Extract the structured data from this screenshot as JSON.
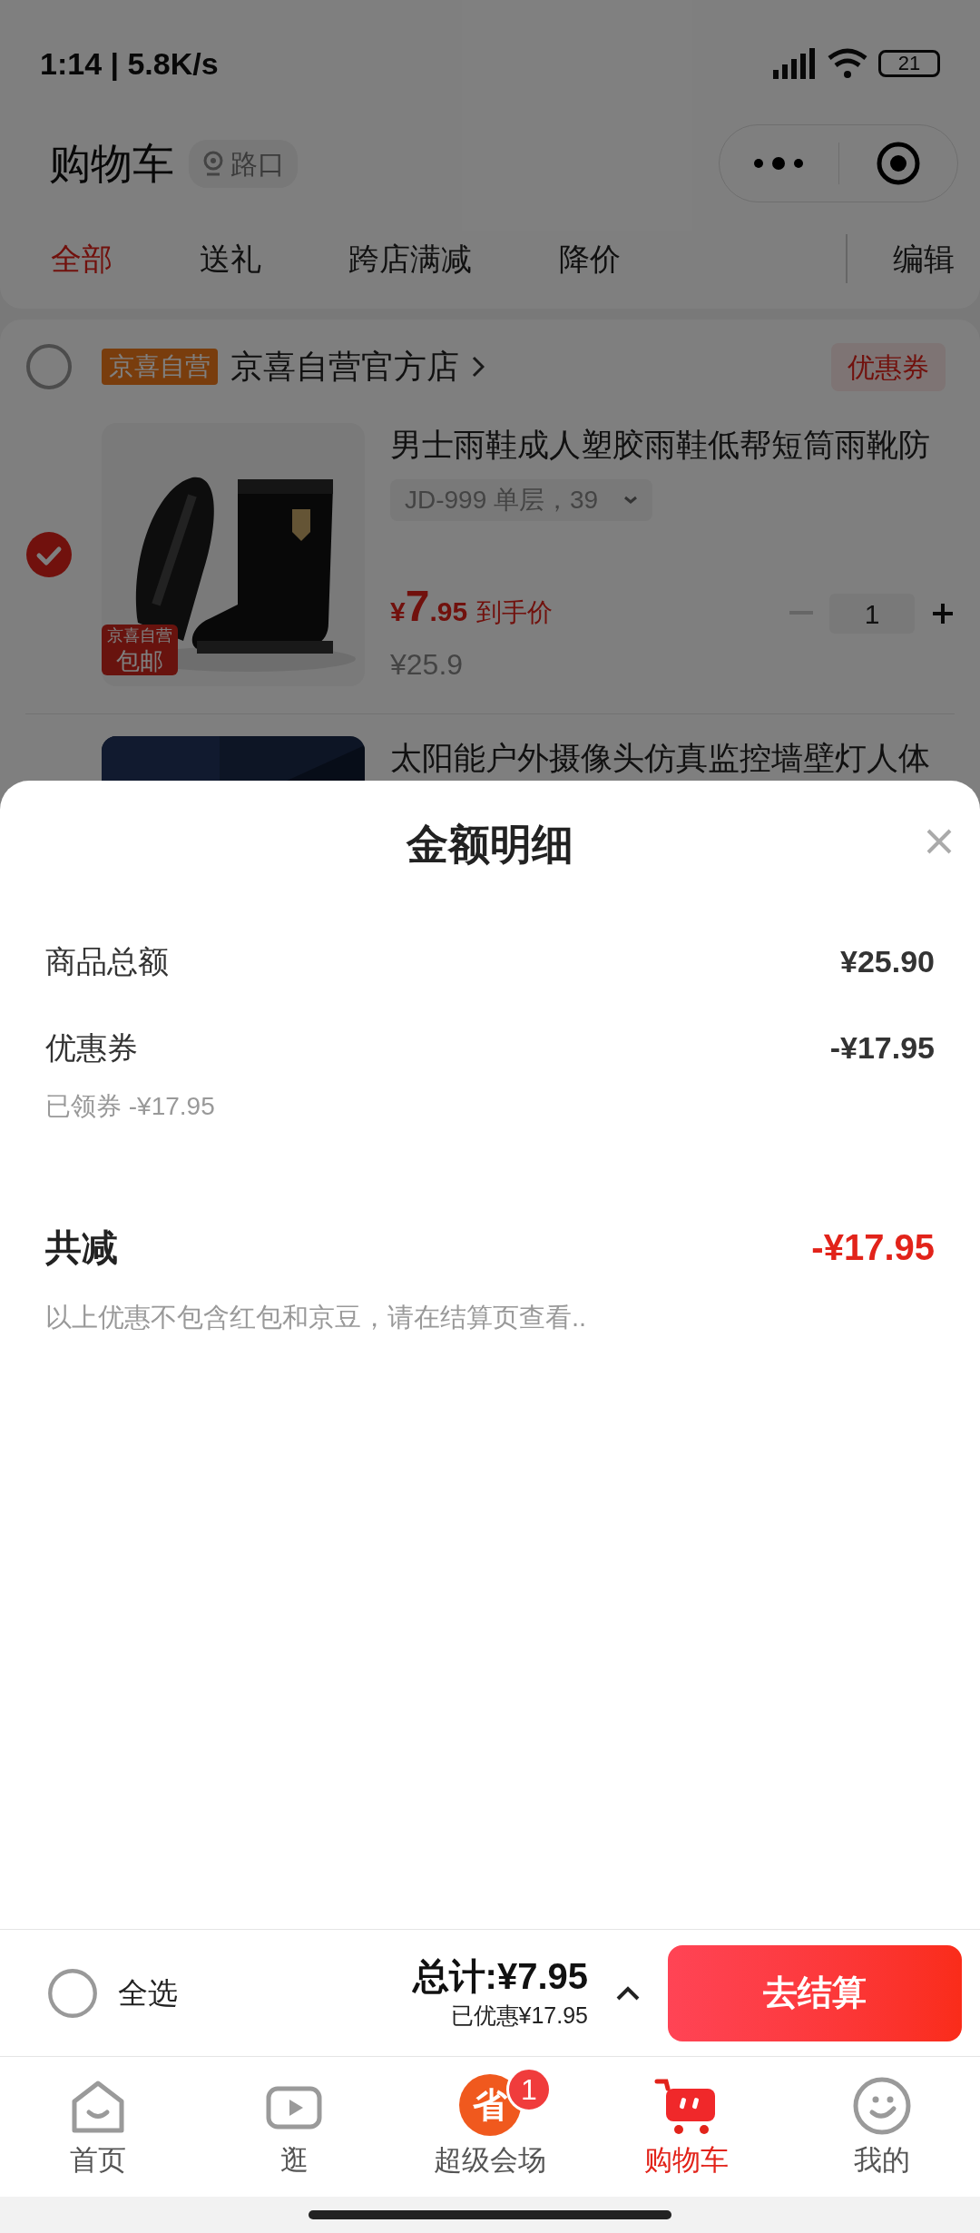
{
  "status_bar": {
    "time": "1:14 | 5.8K/s",
    "battery": "21"
  },
  "header": {
    "title": "购物车",
    "location": "路口"
  },
  "tabs": [
    {
      "label": "全部",
      "selected": true
    },
    {
      "label": "送礼",
      "selected": false
    },
    {
      "label": "跨店满减",
      "selected": false
    },
    {
      "label": "降价",
      "selected": false
    }
  ],
  "edit": "编辑",
  "store": {
    "checked": false,
    "badge": "京喜自营",
    "name": "京喜自营官方店",
    "coupon": "优惠券"
  },
  "products": [
    {
      "checked": true,
      "title": "男士雨鞋成人塑胶雨鞋低帮短筒雨靴防",
      "spec": "JD-999 单层，39",
      "image_badge_top": "京喜自营",
      "image_badge_bottom": "包邮",
      "currency": "¥",
      "price_int": "7",
      "price_dec": ".95",
      "price_label": "到手价",
      "original_price": "¥25.9",
      "quantity": "1"
    },
    {
      "title": "太阳能户外摄像头仿真监控墙壁灯人体"
    }
  ],
  "sheet": {
    "title": "金额明细",
    "rows": [
      {
        "label": "商品总额",
        "value": "¥25.90"
      },
      {
        "label": "优惠券",
        "value": "-¥17.95",
        "note": "已领券 -¥17.95"
      }
    ],
    "total": {
      "label": "共减",
      "value": "-¥17.95"
    },
    "footnote": "以上优惠不包含红包和京豆，请在结算页查看.."
  },
  "checkout_bar": {
    "select_all": {
      "label": "全选",
      "checked": false
    },
    "total": "总计:¥7.95",
    "saved": "已优惠¥17.95",
    "expanded": true,
    "button": "去结算"
  },
  "nav": [
    {
      "kind": "home",
      "label": "首页",
      "selected": false
    },
    {
      "kind": "video",
      "label": "逛",
      "selected": false
    },
    {
      "kind": "promo",
      "label": "超级会场",
      "selected": false,
      "icon_text": "省",
      "badge": "1"
    },
    {
      "kind": "cart",
      "label": "购物车",
      "selected": true
    },
    {
      "kind": "profile",
      "label": "我的",
      "selected": false
    }
  ]
}
